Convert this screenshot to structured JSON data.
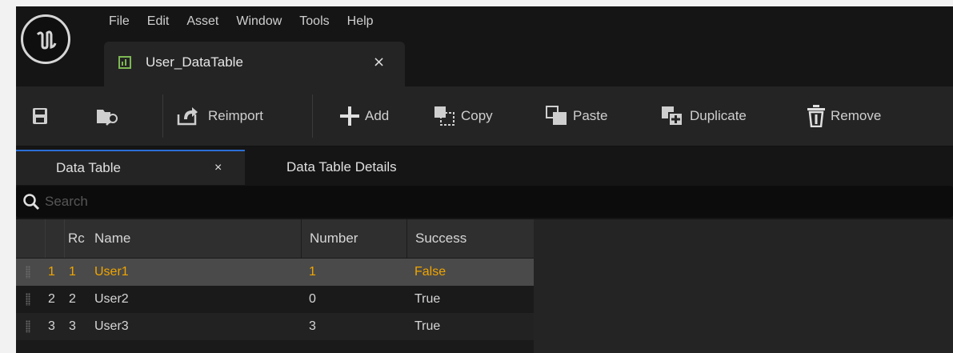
{
  "window": {
    "menu": [
      "File",
      "Edit",
      "Asset",
      "Window",
      "Tools",
      "Help"
    ],
    "document_tab": {
      "label": "User_DataTable",
      "close": "×"
    }
  },
  "toolbar": {
    "reimport_label": "Reimport",
    "add_label": "Add",
    "copy_label": "Copy",
    "paste_label": "Paste",
    "duplicate_label": "Duplicate",
    "remove_label": "Remove"
  },
  "panel_tabs": [
    {
      "label": "Data Table",
      "close": "×",
      "active": true
    },
    {
      "label": "Data Table Details",
      "active": false
    }
  ],
  "search": {
    "placeholder": "Search"
  },
  "table": {
    "columns": [
      "Rc",
      "Name",
      "Number",
      "Success"
    ],
    "rows": [
      {
        "index": "1",
        "row": "1",
        "name": "User1",
        "number": "1",
        "success": "False",
        "selected": true
      },
      {
        "index": "2",
        "row": "2",
        "name": "User2",
        "number": "0",
        "success": "True",
        "selected": false
      },
      {
        "index": "3",
        "row": "3",
        "name": "User3",
        "number": "3",
        "success": "True",
        "selected": false
      }
    ]
  },
  "colors": {
    "accent_blue": "#2b6fd6",
    "selected_text": "#f0a500",
    "selected_row": "#4a4a4a"
  }
}
